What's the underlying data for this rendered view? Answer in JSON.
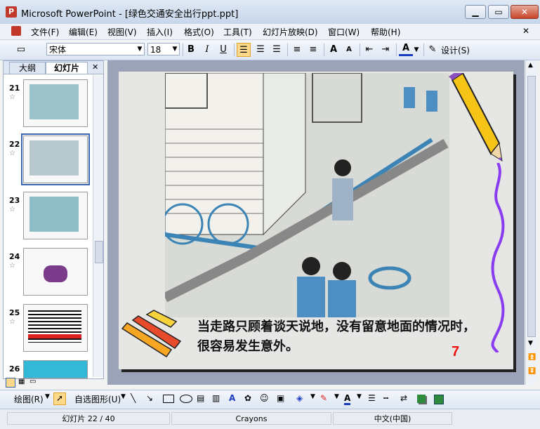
{
  "window": {
    "title": "Microsoft PowerPoint - [绿色交通安全出行ppt.ppt]",
    "app_icon": "P"
  },
  "menu": [
    "文件(F)",
    "编辑(E)",
    "视图(V)",
    "插入(I)",
    "格式(O)",
    "工具(T)",
    "幻灯片放映(D)",
    "窗口(W)",
    "帮助(H)"
  ],
  "toolbar": {
    "font_name": "宋体",
    "font_size": "18",
    "design_label": "设计(S)"
  },
  "left_pane": {
    "tabs": [
      "大纲",
      "幻灯片"
    ],
    "thumbnails": [
      {
        "num": "21",
        "selected": false
      },
      {
        "num": "22",
        "selected": true
      },
      {
        "num": "23",
        "selected": false
      },
      {
        "num": "24",
        "selected": false
      },
      {
        "num": "25",
        "selected": false
      },
      {
        "num": "26",
        "selected": false
      }
    ]
  },
  "slide": {
    "caption": "当走路只顾着谈天说地，没有留意地面的情况时，很容易发生意外。",
    "page_number": "7"
  },
  "drawbar": {
    "draw_label": "绘图(R)",
    "autoshape_label": "自选图形(U)"
  },
  "status": {
    "slide_info": "幻灯片 22 / 40",
    "theme": "Crayons",
    "language": "中文(中国)"
  }
}
